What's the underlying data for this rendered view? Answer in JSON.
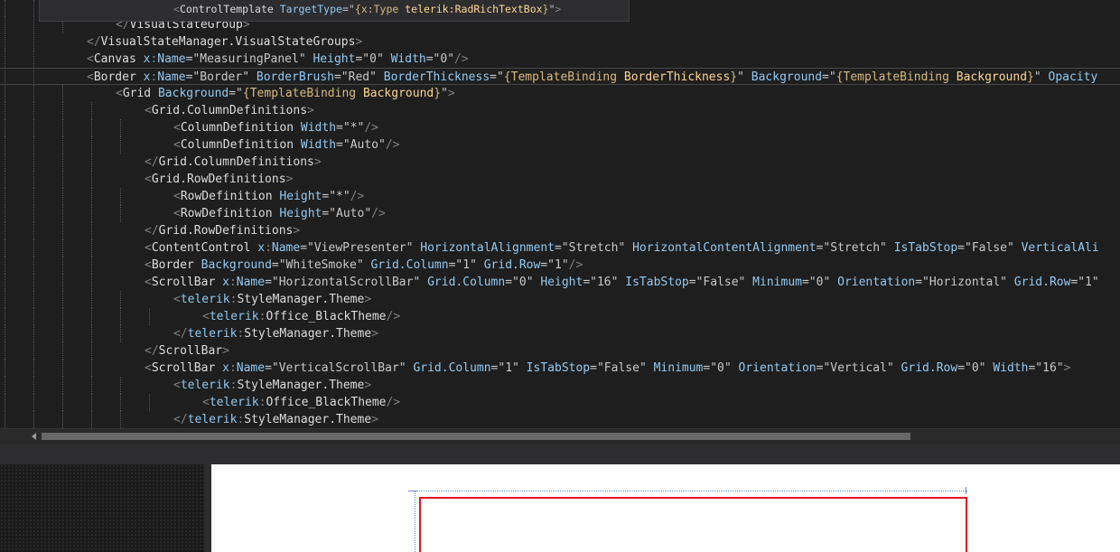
{
  "tooltip": {
    "tokens": [
      {
        "c": "t-d",
        "t": "<"
      },
      {
        "c": "t-e",
        "t": "ControlTemplate"
      },
      {
        "c": "t-a",
        "t": " TargetType"
      },
      {
        "c": "t-q",
        "t": "=\""
      },
      {
        "c": "t-ma",
        "t": "{x:Type "
      },
      {
        "c": "t-me",
        "t": "telerik:RadRichTextBox"
      },
      {
        "c": "t-ma",
        "t": "}"
      },
      {
        "c": "t-q",
        "t": "\""
      },
      {
        "c": "t-d",
        "t": ">"
      }
    ]
  },
  "code_lines": [
    {
      "indent": 4,
      "tokens": [
        {
          "c": "t-d",
          "t": "</"
        },
        {
          "c": "t-e",
          "t": "VisualStateGroup"
        },
        {
          "c": "t-d",
          "t": ">"
        }
      ]
    },
    {
      "indent": 3,
      "tokens": [
        {
          "c": "t-d",
          "t": "</"
        },
        {
          "c": "t-e",
          "t": "VisualStateManager.VisualStateGroups"
        },
        {
          "c": "t-d",
          "t": ">"
        }
      ]
    },
    {
      "indent": 3,
      "tokens": [
        {
          "c": "t-d",
          "t": "<"
        },
        {
          "c": "t-e",
          "t": "Canvas"
        },
        {
          "c": "t-p",
          "t": " x"
        },
        {
          "c": "t-d",
          "t": ":"
        },
        {
          "c": "t-a",
          "t": "Name"
        },
        {
          "c": "t-q",
          "t": "=\""
        },
        {
          "c": "t-v",
          "t": "MeasuringPanel"
        },
        {
          "c": "t-q",
          "t": "\""
        },
        {
          "c": "t-a",
          "t": " Height"
        },
        {
          "c": "t-q",
          "t": "=\""
        },
        {
          "c": "t-v",
          "t": "0"
        },
        {
          "c": "t-q",
          "t": "\""
        },
        {
          "c": "t-a",
          "t": " Width"
        },
        {
          "c": "t-q",
          "t": "=\""
        },
        {
          "c": "t-v",
          "t": "0"
        },
        {
          "c": "t-q",
          "t": "\""
        },
        {
          "c": "t-d",
          "t": "/>"
        }
      ]
    },
    {
      "indent": 3,
      "current": true,
      "tokens": [
        {
          "c": "t-d",
          "t": "<"
        },
        {
          "c": "t-e",
          "t": "Border"
        },
        {
          "c": "t-p",
          "t": " x"
        },
        {
          "c": "t-d",
          "t": ":"
        },
        {
          "c": "t-a",
          "t": "Name"
        },
        {
          "c": "t-q",
          "t": "=\""
        },
        {
          "c": "t-v",
          "t": "Border"
        },
        {
          "c": "t-q",
          "t": "\""
        },
        {
          "c": "t-a",
          "t": " BorderBrush"
        },
        {
          "c": "t-q",
          "t": "=\""
        },
        {
          "c": "t-v",
          "t": "Red"
        },
        {
          "c": "t-q",
          "t": "\""
        },
        {
          "c": "t-a",
          "t": " BorderThickness"
        },
        {
          "c": "t-q",
          "t": "=\""
        },
        {
          "c": "t-ma",
          "t": "{TemplateBinding "
        },
        {
          "c": "t-me",
          "t": "BorderThickness"
        },
        {
          "c": "t-ma",
          "t": "}"
        },
        {
          "c": "t-q",
          "t": "\""
        },
        {
          "c": "t-a",
          "t": " Background"
        },
        {
          "c": "t-q",
          "t": "=\""
        },
        {
          "c": "t-ma",
          "t": "{TemplateBinding "
        },
        {
          "c": "t-me",
          "t": "Background"
        },
        {
          "c": "t-ma",
          "t": "}"
        },
        {
          "c": "t-q",
          "t": "\""
        },
        {
          "c": "t-a",
          "t": " Opacity"
        }
      ]
    },
    {
      "indent": 4,
      "tokens": [
        {
          "c": "t-d",
          "t": "<"
        },
        {
          "c": "t-e",
          "t": "Grid"
        },
        {
          "c": "t-a",
          "t": " Background"
        },
        {
          "c": "t-q",
          "t": "=\""
        },
        {
          "c": "t-ma",
          "t": "{TemplateBinding "
        },
        {
          "c": "t-me",
          "t": "Background"
        },
        {
          "c": "t-ma",
          "t": "}"
        },
        {
          "c": "t-q",
          "t": "\""
        },
        {
          "c": "t-d",
          "t": ">"
        }
      ]
    },
    {
      "indent": 5,
      "tokens": [
        {
          "c": "t-d",
          "t": "<"
        },
        {
          "c": "t-e",
          "t": "Grid.ColumnDefinitions"
        },
        {
          "c": "t-d",
          "t": ">"
        }
      ]
    },
    {
      "indent": 6,
      "tokens": [
        {
          "c": "t-d",
          "t": "<"
        },
        {
          "c": "t-e",
          "t": "ColumnDefinition"
        },
        {
          "c": "t-a",
          "t": " Width"
        },
        {
          "c": "t-q",
          "t": "=\""
        },
        {
          "c": "t-v",
          "t": "*"
        },
        {
          "c": "t-q",
          "t": "\""
        },
        {
          "c": "t-d",
          "t": "/>"
        }
      ]
    },
    {
      "indent": 6,
      "tokens": [
        {
          "c": "t-d",
          "t": "<"
        },
        {
          "c": "t-e",
          "t": "ColumnDefinition"
        },
        {
          "c": "t-a",
          "t": " Width"
        },
        {
          "c": "t-q",
          "t": "=\""
        },
        {
          "c": "t-v",
          "t": "Auto"
        },
        {
          "c": "t-q",
          "t": "\""
        },
        {
          "c": "t-d",
          "t": "/>"
        }
      ]
    },
    {
      "indent": 5,
      "tokens": [
        {
          "c": "t-d",
          "t": "</"
        },
        {
          "c": "t-e",
          "t": "Grid.ColumnDefinitions"
        },
        {
          "c": "t-d",
          "t": ">"
        }
      ]
    },
    {
      "indent": 5,
      "tokens": [
        {
          "c": "t-d",
          "t": "<"
        },
        {
          "c": "t-e",
          "t": "Grid.RowDefinitions"
        },
        {
          "c": "t-d",
          "t": ">"
        }
      ]
    },
    {
      "indent": 6,
      "tokens": [
        {
          "c": "t-d",
          "t": "<"
        },
        {
          "c": "t-e",
          "t": "RowDefinition"
        },
        {
          "c": "t-a",
          "t": " Height"
        },
        {
          "c": "t-q",
          "t": "=\""
        },
        {
          "c": "t-v",
          "t": "*"
        },
        {
          "c": "t-q",
          "t": "\""
        },
        {
          "c": "t-d",
          "t": "/>"
        }
      ]
    },
    {
      "indent": 6,
      "tokens": [
        {
          "c": "t-d",
          "t": "<"
        },
        {
          "c": "t-e",
          "t": "RowDefinition"
        },
        {
          "c": "t-a",
          "t": " Height"
        },
        {
          "c": "t-q",
          "t": "=\""
        },
        {
          "c": "t-v",
          "t": "Auto"
        },
        {
          "c": "t-q",
          "t": "\""
        },
        {
          "c": "t-d",
          "t": "/>"
        }
      ]
    },
    {
      "indent": 5,
      "tokens": [
        {
          "c": "t-d",
          "t": "</"
        },
        {
          "c": "t-e",
          "t": "Grid.RowDefinitions"
        },
        {
          "c": "t-d",
          "t": ">"
        }
      ]
    },
    {
      "indent": 5,
      "tokens": [
        {
          "c": "t-d",
          "t": "<"
        },
        {
          "c": "t-e",
          "t": "ContentControl"
        },
        {
          "c": "t-p",
          "t": " x"
        },
        {
          "c": "t-d",
          "t": ":"
        },
        {
          "c": "t-a",
          "t": "Name"
        },
        {
          "c": "t-q",
          "t": "=\""
        },
        {
          "c": "t-v",
          "t": "ViewPresenter"
        },
        {
          "c": "t-q",
          "t": "\""
        },
        {
          "c": "t-a",
          "t": " HorizontalAlignment"
        },
        {
          "c": "t-q",
          "t": "=\""
        },
        {
          "c": "t-v",
          "t": "Stretch"
        },
        {
          "c": "t-q",
          "t": "\""
        },
        {
          "c": "t-a",
          "t": " HorizontalContentAlignment"
        },
        {
          "c": "t-q",
          "t": "=\""
        },
        {
          "c": "t-v",
          "t": "Stretch"
        },
        {
          "c": "t-q",
          "t": "\""
        },
        {
          "c": "t-a",
          "t": " IsTabStop"
        },
        {
          "c": "t-q",
          "t": "=\""
        },
        {
          "c": "t-v",
          "t": "False"
        },
        {
          "c": "t-q",
          "t": "\""
        },
        {
          "c": "t-a",
          "t": " VerticalAli"
        }
      ]
    },
    {
      "indent": 5,
      "tokens": [
        {
          "c": "t-d",
          "t": "<"
        },
        {
          "c": "t-e",
          "t": "Border"
        },
        {
          "c": "t-a",
          "t": " Background"
        },
        {
          "c": "t-q",
          "t": "=\""
        },
        {
          "c": "t-v",
          "t": "WhiteSmoke"
        },
        {
          "c": "t-q",
          "t": "\""
        },
        {
          "c": "t-a",
          "t": " Grid.Column"
        },
        {
          "c": "t-q",
          "t": "=\""
        },
        {
          "c": "t-v",
          "t": "1"
        },
        {
          "c": "t-q",
          "t": "\""
        },
        {
          "c": "t-a",
          "t": " Grid.Row"
        },
        {
          "c": "t-q",
          "t": "=\""
        },
        {
          "c": "t-v",
          "t": "1"
        },
        {
          "c": "t-q",
          "t": "\""
        },
        {
          "c": "t-d",
          "t": "/>"
        }
      ]
    },
    {
      "indent": 5,
      "tokens": [
        {
          "c": "t-d",
          "t": "<"
        },
        {
          "c": "t-e",
          "t": "ScrollBar"
        },
        {
          "c": "t-p",
          "t": " x"
        },
        {
          "c": "t-d",
          "t": ":"
        },
        {
          "c": "t-a",
          "t": "Name"
        },
        {
          "c": "t-q",
          "t": "=\""
        },
        {
          "c": "t-v",
          "t": "HorizontalScrollBar"
        },
        {
          "c": "t-q",
          "t": "\""
        },
        {
          "c": "t-a",
          "t": " Grid.Column"
        },
        {
          "c": "t-q",
          "t": "=\""
        },
        {
          "c": "t-v",
          "t": "0"
        },
        {
          "c": "t-q",
          "t": "\""
        },
        {
          "c": "t-a",
          "t": " Height"
        },
        {
          "c": "t-q",
          "t": "=\""
        },
        {
          "c": "t-v",
          "t": "16"
        },
        {
          "c": "t-q",
          "t": "\""
        },
        {
          "c": "t-a",
          "t": " IsTabStop"
        },
        {
          "c": "t-q",
          "t": "=\""
        },
        {
          "c": "t-v",
          "t": "False"
        },
        {
          "c": "t-q",
          "t": "\""
        },
        {
          "c": "t-a",
          "t": " Minimum"
        },
        {
          "c": "t-q",
          "t": "=\""
        },
        {
          "c": "t-v",
          "t": "0"
        },
        {
          "c": "t-q",
          "t": "\""
        },
        {
          "c": "t-a",
          "t": " Orientation"
        },
        {
          "c": "t-q",
          "t": "=\""
        },
        {
          "c": "t-v",
          "t": "Horizontal"
        },
        {
          "c": "t-q",
          "t": "\""
        },
        {
          "c": "t-a",
          "t": " Grid.Row"
        },
        {
          "c": "t-q",
          "t": "=\""
        },
        {
          "c": "t-v",
          "t": "1"
        },
        {
          "c": "t-q",
          "t": "\""
        }
      ]
    },
    {
      "indent": 6,
      "tokens": [
        {
          "c": "t-d",
          "t": "<"
        },
        {
          "c": "t-p",
          "t": "telerik"
        },
        {
          "c": "t-d",
          "t": ":"
        },
        {
          "c": "t-e",
          "t": "StyleManager.Theme"
        },
        {
          "c": "t-d",
          "t": ">"
        }
      ]
    },
    {
      "indent": 7,
      "tokens": [
        {
          "c": "t-d",
          "t": "<"
        },
        {
          "c": "t-p",
          "t": "telerik"
        },
        {
          "c": "t-d",
          "t": ":"
        },
        {
          "c": "t-e",
          "t": "Office_BlackTheme"
        },
        {
          "c": "t-d",
          "t": "/>"
        }
      ]
    },
    {
      "indent": 6,
      "tokens": [
        {
          "c": "t-d",
          "t": "</"
        },
        {
          "c": "t-p",
          "t": "telerik"
        },
        {
          "c": "t-d",
          "t": ":"
        },
        {
          "c": "t-e",
          "t": "StyleManager.Theme"
        },
        {
          "c": "t-d",
          "t": ">"
        }
      ]
    },
    {
      "indent": 5,
      "tokens": [
        {
          "c": "t-d",
          "t": "</"
        },
        {
          "c": "t-e",
          "t": "ScrollBar"
        },
        {
          "c": "t-d",
          "t": ">"
        }
      ]
    },
    {
      "indent": 5,
      "tokens": [
        {
          "c": "t-d",
          "t": "<"
        },
        {
          "c": "t-e",
          "t": "ScrollBar"
        },
        {
          "c": "t-p",
          "t": " x"
        },
        {
          "c": "t-d",
          "t": ":"
        },
        {
          "c": "t-a",
          "t": "Name"
        },
        {
          "c": "t-q",
          "t": "=\""
        },
        {
          "c": "t-v",
          "t": "VerticalScrollBar"
        },
        {
          "c": "t-q",
          "t": "\""
        },
        {
          "c": "t-a",
          "t": " Grid.Column"
        },
        {
          "c": "t-q",
          "t": "=\""
        },
        {
          "c": "t-v",
          "t": "1"
        },
        {
          "c": "t-q",
          "t": "\""
        },
        {
          "c": "t-a",
          "t": " IsTabStop"
        },
        {
          "c": "t-q",
          "t": "=\""
        },
        {
          "c": "t-v",
          "t": "False"
        },
        {
          "c": "t-q",
          "t": "\""
        },
        {
          "c": "t-a",
          "t": " Minimum"
        },
        {
          "c": "t-q",
          "t": "=\""
        },
        {
          "c": "t-v",
          "t": "0"
        },
        {
          "c": "t-q",
          "t": "\""
        },
        {
          "c": "t-a",
          "t": " Orientation"
        },
        {
          "c": "t-q",
          "t": "=\""
        },
        {
          "c": "t-v",
          "t": "Vertical"
        },
        {
          "c": "t-q",
          "t": "\""
        },
        {
          "c": "t-a",
          "t": " Grid.Row"
        },
        {
          "c": "t-q",
          "t": "=\""
        },
        {
          "c": "t-v",
          "t": "0"
        },
        {
          "c": "t-q",
          "t": "\""
        },
        {
          "c": "t-a",
          "t": " Width"
        },
        {
          "c": "t-q",
          "t": "=\""
        },
        {
          "c": "t-v",
          "t": "16"
        },
        {
          "c": "t-q",
          "t": "\""
        },
        {
          "c": "t-d",
          "t": ">"
        }
      ]
    },
    {
      "indent": 6,
      "tokens": [
        {
          "c": "t-d",
          "t": "<"
        },
        {
          "c": "t-p",
          "t": "telerik"
        },
        {
          "c": "t-d",
          "t": ":"
        },
        {
          "c": "t-e",
          "t": "StyleManager.Theme"
        },
        {
          "c": "t-d",
          "t": ">"
        }
      ]
    },
    {
      "indent": 7,
      "tokens": [
        {
          "c": "t-d",
          "t": "<"
        },
        {
          "c": "t-p",
          "t": "telerik"
        },
        {
          "c": "t-d",
          "t": ":"
        },
        {
          "c": "t-e",
          "t": "Office_BlackTheme"
        },
        {
          "c": "t-d",
          "t": "/>"
        }
      ]
    },
    {
      "indent": 6,
      "tokens": [
        {
          "c": "t-d",
          "t": "</"
        },
        {
          "c": "t-p",
          "t": "telerik"
        },
        {
          "c": "t-d",
          "t": ":"
        },
        {
          "c": "t-e",
          "t": "StyleManager.Theme"
        },
        {
          "c": "t-d",
          "t": ">"
        }
      ]
    }
  ],
  "colors": {
    "editor_background": "#1e1e1e",
    "design_surface": "#ffffff",
    "border_brush": "#e81123"
  },
  "icons": {
    "scroll_left": "chevron-left-icon"
  }
}
